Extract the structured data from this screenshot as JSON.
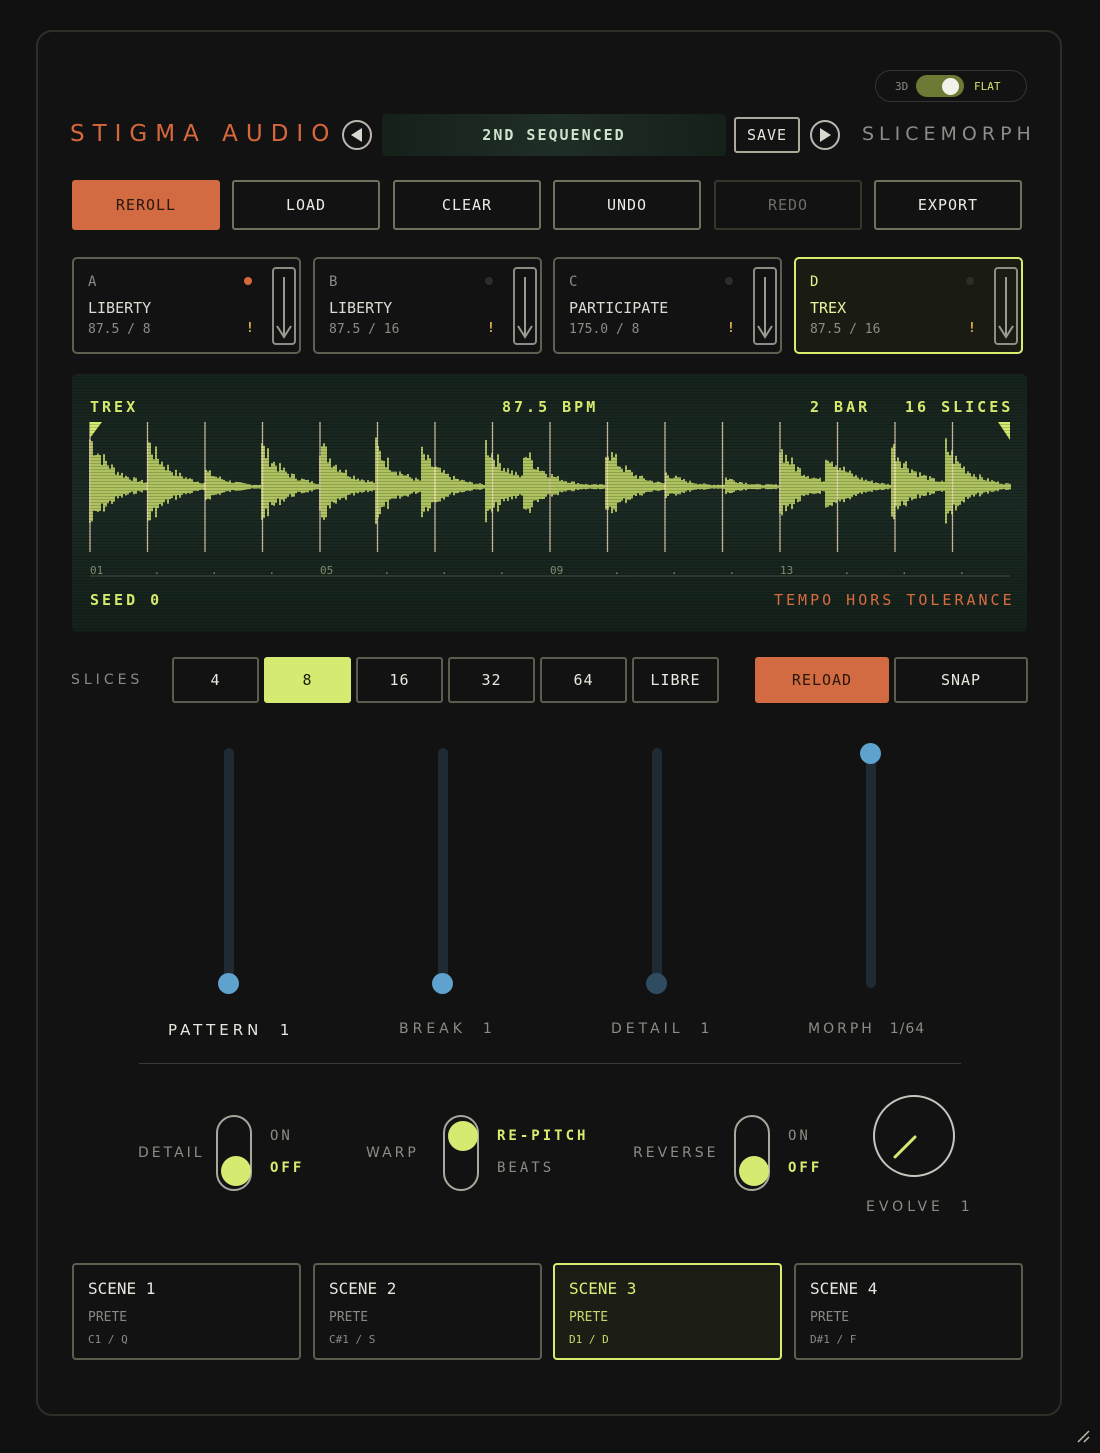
{
  "header": {
    "brand": "STIGMA AUDIO",
    "preset_name": "2ND SEQUENCED",
    "save_label": "SAVE",
    "product": "SLICEMORPH",
    "mode_switch": {
      "left_label": "3D",
      "right_label": "FLAT",
      "selected": "FLAT"
    }
  },
  "toolbar": {
    "reroll": "REROLL",
    "load": "LOAD",
    "clear": "CLEAR",
    "undo": "UNDO",
    "redo": "REDO",
    "export": "EXPORT"
  },
  "slots": [
    {
      "letter": "A",
      "name": "LIBERTY",
      "meta": "87.5 / 8",
      "warn": "!",
      "recording": true,
      "active": false
    },
    {
      "letter": "B",
      "name": "LIBERTY",
      "meta": "87.5 / 16",
      "warn": "!",
      "recording": false,
      "active": false
    },
    {
      "letter": "C",
      "name": "PARTICIPATE",
      "meta": "175.0 / 8",
      "warn": "!",
      "recording": false,
      "active": false
    },
    {
      "letter": "D",
      "name": "TREX",
      "meta": "87.5 / 16",
      "warn": "!",
      "recording": false,
      "active": true
    }
  ],
  "waveform": {
    "sample": "TREX",
    "bpm": "87.5 BPM",
    "bars": "2 BAR",
    "slices": "16 SLICES",
    "seed": "SEED 0",
    "status": "TEMPO HORS TOLERANCE",
    "markers": [
      "01",
      ".",
      ".",
      ".",
      "05",
      ".",
      ".",
      ".",
      "09",
      ".",
      ".",
      ".",
      "13",
      ".",
      ".",
      "."
    ]
  },
  "slice_select": {
    "label": "SLICES",
    "options": [
      "4",
      "8",
      "16",
      "32",
      "64",
      "LIBRE"
    ],
    "selected": "8",
    "reload": "RELOAD",
    "snap": "SNAP"
  },
  "faders": [
    {
      "label": "PATTERN",
      "value": "1",
      "level": 0.0,
      "highlight": true
    },
    {
      "label": "BREAK",
      "value": "1",
      "level": 0.0,
      "highlight": false
    },
    {
      "label": "DETAIL",
      "value": "1",
      "level": 0.0,
      "highlight": false,
      "dim": true
    },
    {
      "label": "MORPH",
      "value": "1/64",
      "level": 1.0,
      "highlight": false
    }
  ],
  "toggles": {
    "detail": {
      "label": "DETAIL",
      "on": "ON",
      "off": "OFF",
      "state": "OFF"
    },
    "warp": {
      "label": "WARP",
      "on": "RE-PITCH",
      "off": "BEATS",
      "state": "RE-PITCH"
    },
    "reverse": {
      "label": "REVERSE",
      "on": "ON",
      "off": "OFF",
      "state": "OFF"
    }
  },
  "evolve": {
    "label": "EVOLVE",
    "value": "1"
  },
  "scenes": [
    {
      "title": "SCENE 1",
      "state": "PRETE",
      "keys": "C1 / Q",
      "active": false
    },
    {
      "title": "SCENE 2",
      "state": "PRETE",
      "keys": "C#1 / S",
      "active": false
    },
    {
      "title": "SCENE 3",
      "state": "PRETE",
      "keys": "D1 / D",
      "active": true
    },
    {
      "title": "SCENE 4",
      "state": "PRETE",
      "keys": "D#1 / F",
      "active": false
    }
  ],
  "colors": {
    "accent": "#d4ea70",
    "orange": "#d26a42",
    "fader_blue": "#5ea2cd",
    "bg": "#111112"
  },
  "icons": {
    "prev": "chevron-left-icon",
    "next": "chevron-right-icon",
    "download": "download-arrow-icon"
  }
}
